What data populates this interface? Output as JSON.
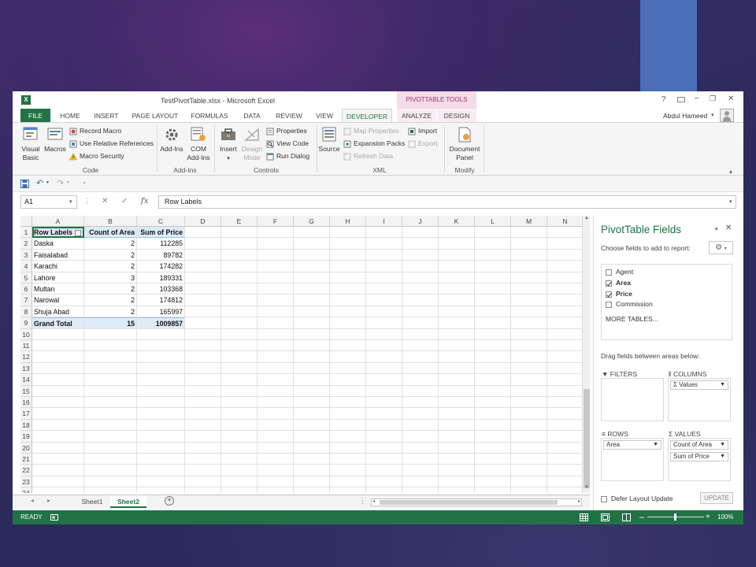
{
  "window_title": "TestPivotTable.xlsx - Microsoft Excel",
  "contextual_tab_group": "PIVOTTABLE TOOLS",
  "user_name": "Abdul Hameed",
  "window_controls": {
    "help": "?",
    "minimize": "–",
    "restore": "❐",
    "close": "✕"
  },
  "tabs": [
    {
      "label": "FILE"
    },
    {
      "label": "HOME"
    },
    {
      "label": "INSERT"
    },
    {
      "label": "PAGE LAYOUT"
    },
    {
      "label": "FORMULAS"
    },
    {
      "label": "DATA"
    },
    {
      "label": "REVIEW"
    },
    {
      "label": "VIEW"
    },
    {
      "label": "DEVELOPER"
    },
    {
      "label": "ANALYZE"
    },
    {
      "label": "DESIGN"
    }
  ],
  "active_tab": "DEVELOPER",
  "ribbon": {
    "code": {
      "visual_basic": "Visual\nBasic",
      "macros": "Macros",
      "record_macro": "Record Macro",
      "relative_refs": "Use Relative References",
      "macro_security": "Macro Security",
      "group": "Code"
    },
    "addins": {
      "addins": "Add-Ins",
      "com_addins": "COM\nAdd-Ins",
      "group": "Add-Ins"
    },
    "controls": {
      "insert": "Insert",
      "design_mode": "Design\nMode",
      "properties": "Properties",
      "view_code": "View Code",
      "run_dialog": "Run Dialog",
      "group": "Controls"
    },
    "xml": {
      "source": "Source",
      "map_properties": "Map Properties",
      "expansion_packs": "Expansion Packs",
      "refresh_data": "Refresh Data",
      "import": "Import",
      "export": "Export",
      "group": "XML"
    },
    "modify": {
      "document_panel": "Document\nPanel",
      "group": "Modify"
    }
  },
  "formula_bar": {
    "name_box": "A1",
    "fx": "fx",
    "content": "Row Labels"
  },
  "columns": [
    "A",
    "B",
    "C",
    "D",
    "E",
    "F",
    "G",
    "H",
    "I",
    "J",
    "K",
    "L",
    "M",
    "N"
  ],
  "rows": [
    "1",
    "2",
    "3",
    "4",
    "5",
    "6",
    "7",
    "8",
    "9",
    "10",
    "11",
    "12",
    "13",
    "14",
    "15",
    "16",
    "17",
    "18",
    "19",
    "20",
    "21",
    "22",
    "23",
    "24"
  ],
  "pivot": {
    "headers": [
      "Row Labels",
      "Count of Area",
      "Sum of Price"
    ],
    "data": [
      {
        "label": "Daska",
        "count": "2",
        "sum": "112285"
      },
      {
        "label": "Faisalabad",
        "count": "2",
        "sum": "89782"
      },
      {
        "label": "Karachi",
        "count": "2",
        "sum": "174282"
      },
      {
        "label": "Lahore",
        "count": "3",
        "sum": "189331"
      },
      {
        "label": "Multan",
        "count": "2",
        "sum": "103368"
      },
      {
        "label": "Narowal",
        "count": "2",
        "sum": "174812"
      },
      {
        "label": "Shuja Abad",
        "count": "2",
        "sum": "165997"
      }
    ],
    "total": {
      "label": "Grand Total",
      "count": "15",
      "sum": "1009857"
    }
  },
  "sheet_tabs": [
    {
      "label": "Sheet1"
    },
    {
      "label": "Sheet2"
    }
  ],
  "active_sheet": "Sheet2",
  "status": {
    "ready": "READY",
    "zoom": "100%",
    "zoom_level": 1.0
  },
  "panel": {
    "title": "PivotTable Fields",
    "choose_label": "Choose fields to add to report:",
    "fields": [
      {
        "name": "Agent",
        "checked": false
      },
      {
        "name": "Area",
        "checked": true
      },
      {
        "name": "Price",
        "checked": true
      },
      {
        "name": "Commission",
        "checked": false
      }
    ],
    "more_tables": "MORE TABLES...",
    "drag_label": "Drag fields between areas below:",
    "filters_label": "FILTERS",
    "columns_label": "COLUMNS",
    "rows_label": "ROWS",
    "values_label": "VALUES",
    "columns_items": [
      "Values"
    ],
    "rows_items": [
      "Area"
    ],
    "values_items": [
      "Count of Area",
      "Sum of Price"
    ],
    "defer_label": "Defer Layout Update",
    "update_button": "UPDATE"
  },
  "colors": {
    "excel_green": "#217346",
    "pivot_header": "#DDEBF7",
    "contextual_pink": "#F3DBE9"
  }
}
